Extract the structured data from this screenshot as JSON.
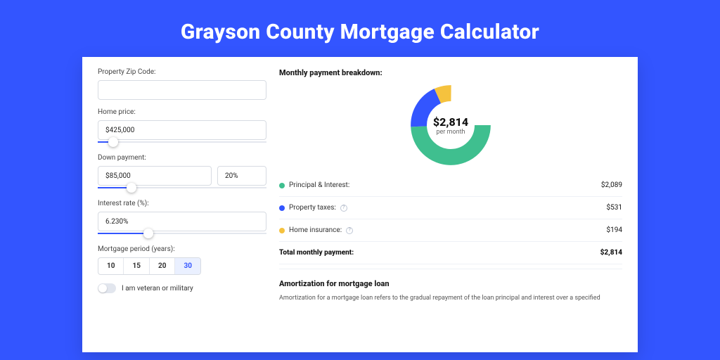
{
  "title": "Grayson County Mortgage Calculator",
  "colors": {
    "pi": "#3fbf8f",
    "tax": "#3355ff",
    "ins": "#f5c23e"
  },
  "left": {
    "zip_label": "Property Zip Code:",
    "zip_value": "",
    "price_label": "Home price:",
    "price_value": "$425,000",
    "price_slider_pct": 9,
    "down_label": "Down payment:",
    "down_value": "$85,000",
    "down_pct": "20%",
    "down_slider_pct": 20,
    "rate_label": "Interest rate (%):",
    "rate_value": "6.230%",
    "rate_slider_pct": 30,
    "period_label": "Mortgage period (years):",
    "periods": [
      "10",
      "15",
      "20",
      "30"
    ],
    "period_selected": "30",
    "veteran_label": "I am veteran or military"
  },
  "right": {
    "breakdown_label": "Monthly payment breakdown:",
    "donut_amount": "$2,814",
    "donut_per": "per month",
    "pi_label": "Principal & Interest:",
    "pi_value": "$2,089",
    "tax_label": "Property taxes:",
    "tax_value": "$531",
    "ins_label": "Home insurance:",
    "ins_value": "$194",
    "total_label": "Total monthly payment:",
    "total_value": "$2,814",
    "amort_title": "Amortization for mortgage loan",
    "amort_text": "Amortization for a mortgage loan refers to the gradual repayment of the loan principal and interest over a specified"
  },
  "chart_data": {
    "type": "pie",
    "title": "Monthly payment breakdown",
    "series": [
      {
        "name": "Principal & Interest",
        "value": 2089,
        "color": "#3fbf8f"
      },
      {
        "name": "Property taxes",
        "value": 531,
        "color": "#3355ff"
      },
      {
        "name": "Home insurance",
        "value": 194,
        "color": "#f5c23e"
      }
    ],
    "total": 2814,
    "unit": "USD/month"
  }
}
